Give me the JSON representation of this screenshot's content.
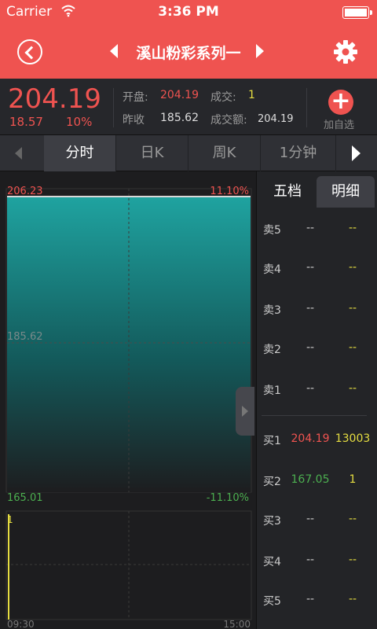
{
  "status": {
    "carrier": "Carrier",
    "time": "3:36 PM"
  },
  "nav": {
    "title": "溪山粉彩系列一"
  },
  "quote": {
    "price": "204.19",
    "change": "18.57",
    "change_pct": "10%",
    "open_label": "开盘:",
    "open": "204.19",
    "volume_label": "成交:",
    "volume": "1",
    "prev_close_label": "昨收",
    "prev_close": "185.62",
    "turnover_label": "成交额:",
    "turnover": "204.19",
    "add_label": "加自选"
  },
  "tabs": [
    "分时",
    "日K",
    "周K",
    "1分钟"
  ],
  "chart": {
    "high": "206.23",
    "high_pct": "11.10%",
    "mid": "185.62",
    "low": "165.01",
    "low_pct": "-11.10%",
    "start_time": "09:30",
    "end_time": "15:00",
    "volume_marker": "1"
  },
  "panel": {
    "tabs": [
      "五档",
      "明细"
    ],
    "asks": [
      {
        "side": "卖5",
        "price": "--",
        "vol": "--"
      },
      {
        "side": "卖4",
        "price": "--",
        "vol": "--"
      },
      {
        "side": "卖3",
        "price": "--",
        "vol": "--"
      },
      {
        "side": "卖2",
        "price": "--",
        "vol": "--"
      },
      {
        "side": "卖1",
        "price": "--",
        "vol": "--"
      }
    ],
    "bids": [
      {
        "side": "买1",
        "price": "204.19",
        "vol": "13003"
      },
      {
        "side": "买2",
        "price": "167.05",
        "vol": "1"
      },
      {
        "side": "买3",
        "price": "--",
        "vol": "--"
      },
      {
        "side": "买4",
        "price": "--",
        "vol": "--"
      },
      {
        "side": "买5",
        "price": "--",
        "vol": "--"
      }
    ]
  },
  "colors": {
    "up": "#ef5350",
    "down": "#4caf50",
    "neutral": "#cccccc",
    "volume": "#e5dd41"
  }
}
